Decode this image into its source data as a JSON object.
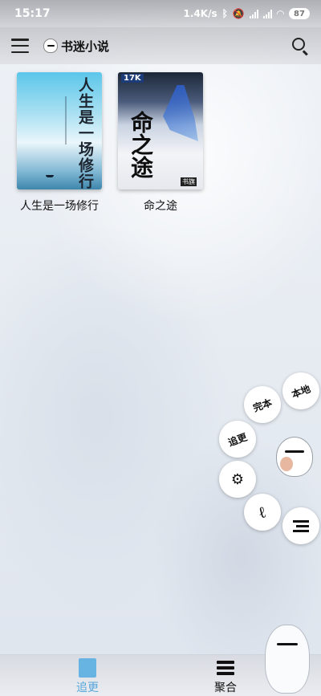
{
  "status_bar": {
    "time": "15:17",
    "network_speed": "1.4K/s",
    "battery": "87"
  },
  "app_bar": {
    "title": "书迷小说",
    "menu_icon": "hamburger-menu-icon",
    "search_icon": "search-icon"
  },
  "bookshelf": {
    "books": [
      {
        "title": "人生是一场修行",
        "cover_text": "人生是一场修行"
      },
      {
        "title": "命之途",
        "cover_text": "命之途",
        "cover_brand": "17K",
        "cover_publisher": "书旗"
      }
    ]
  },
  "float_menu": {
    "complete": "完本",
    "local": "本地",
    "follow": "追更",
    "settings_icon": "gear-icon",
    "brand_icon": "e-logo-icon",
    "list_icon": "list-icon"
  },
  "bottom_nav": {
    "tabs": [
      {
        "label": "追更",
        "icon": "book-icon",
        "active": true
      },
      {
        "label": "聚合",
        "icon": "stack-icon",
        "active": false
      }
    ]
  },
  "colors": {
    "accent": "#55a6dc",
    "text": "#111111"
  }
}
